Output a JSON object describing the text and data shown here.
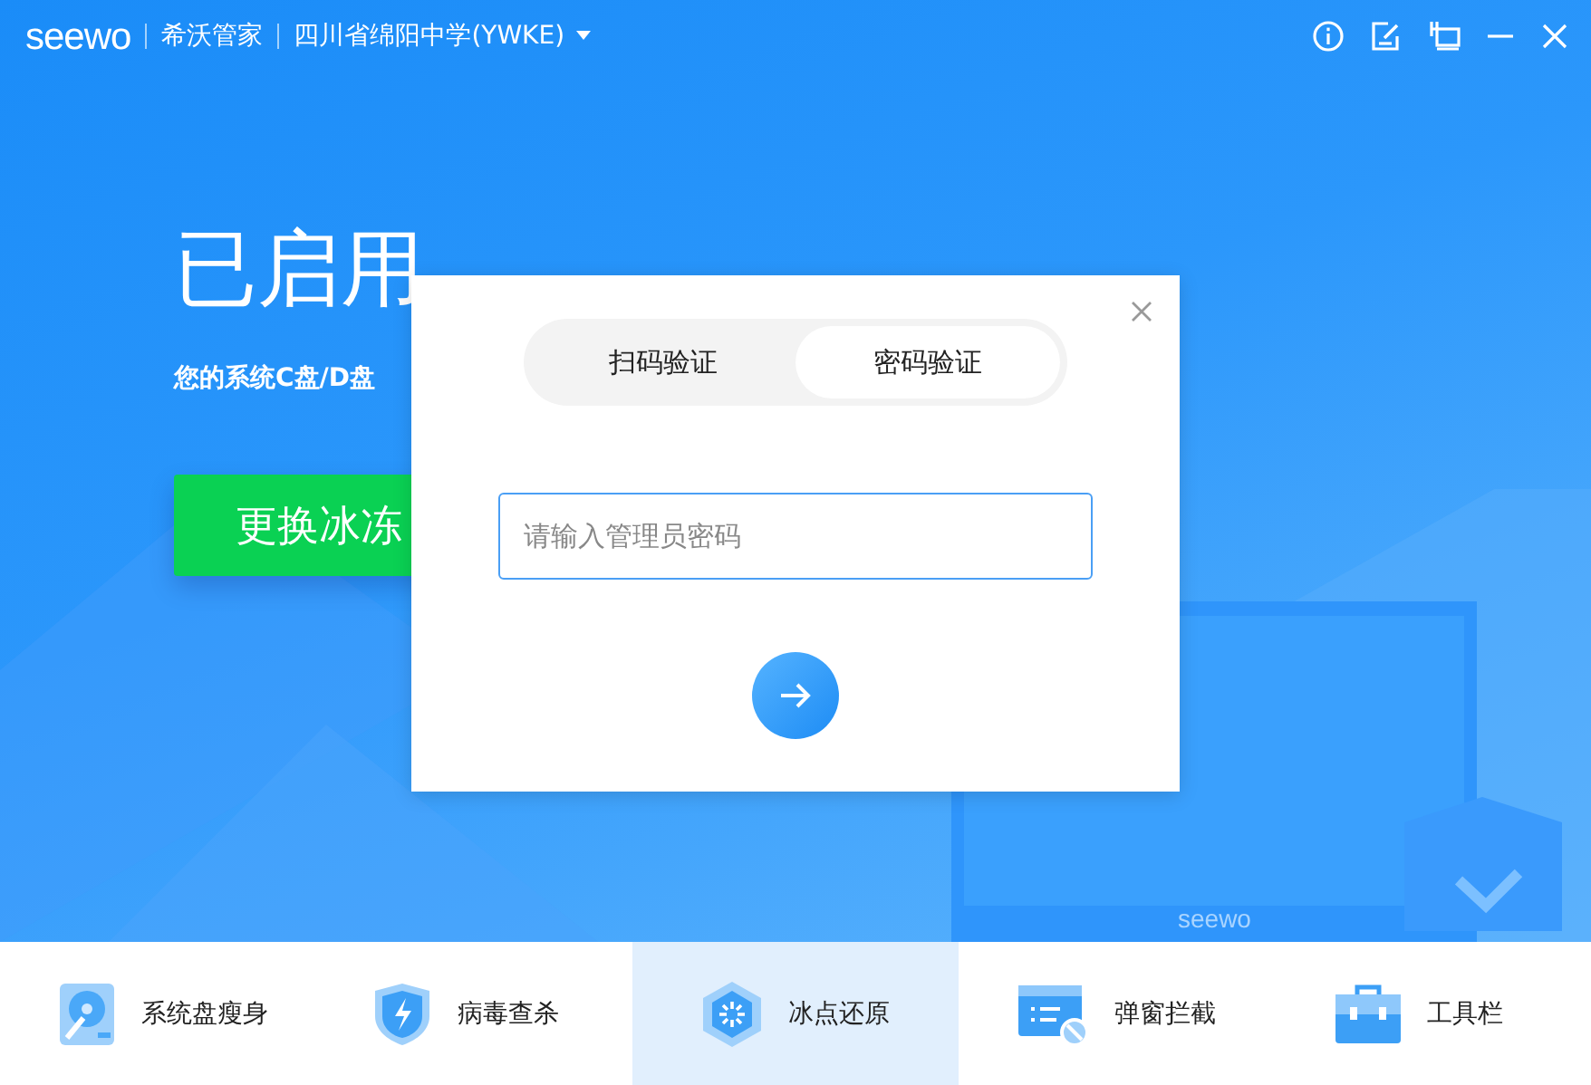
{
  "header": {
    "logo": "seewo",
    "app_name": "希沃管家",
    "school": "四川省绵阳中学(YWKE)"
  },
  "hero": {
    "title": "已启用",
    "subtitle": "您的系统C盘/D盘",
    "button": "更换冰冻",
    "monitor_logo": "seewo"
  },
  "dialog": {
    "tabs": [
      {
        "label": "扫码验证",
        "selected": false
      },
      {
        "label": "密码验证",
        "selected": true
      }
    ],
    "password": {
      "placeholder": "请输入管理员密码"
    }
  },
  "nav": [
    {
      "label": "系统盘瘦身",
      "kind": "disk",
      "selected": false
    },
    {
      "label": "病毒查杀",
      "kind": "shield",
      "selected": false
    },
    {
      "label": "冰点还原",
      "kind": "freeze",
      "selected": true
    },
    {
      "label": "弹窗拦截",
      "kind": "popup",
      "selected": false
    },
    {
      "label": "工具栏",
      "kind": "toolbox",
      "selected": false
    }
  ]
}
